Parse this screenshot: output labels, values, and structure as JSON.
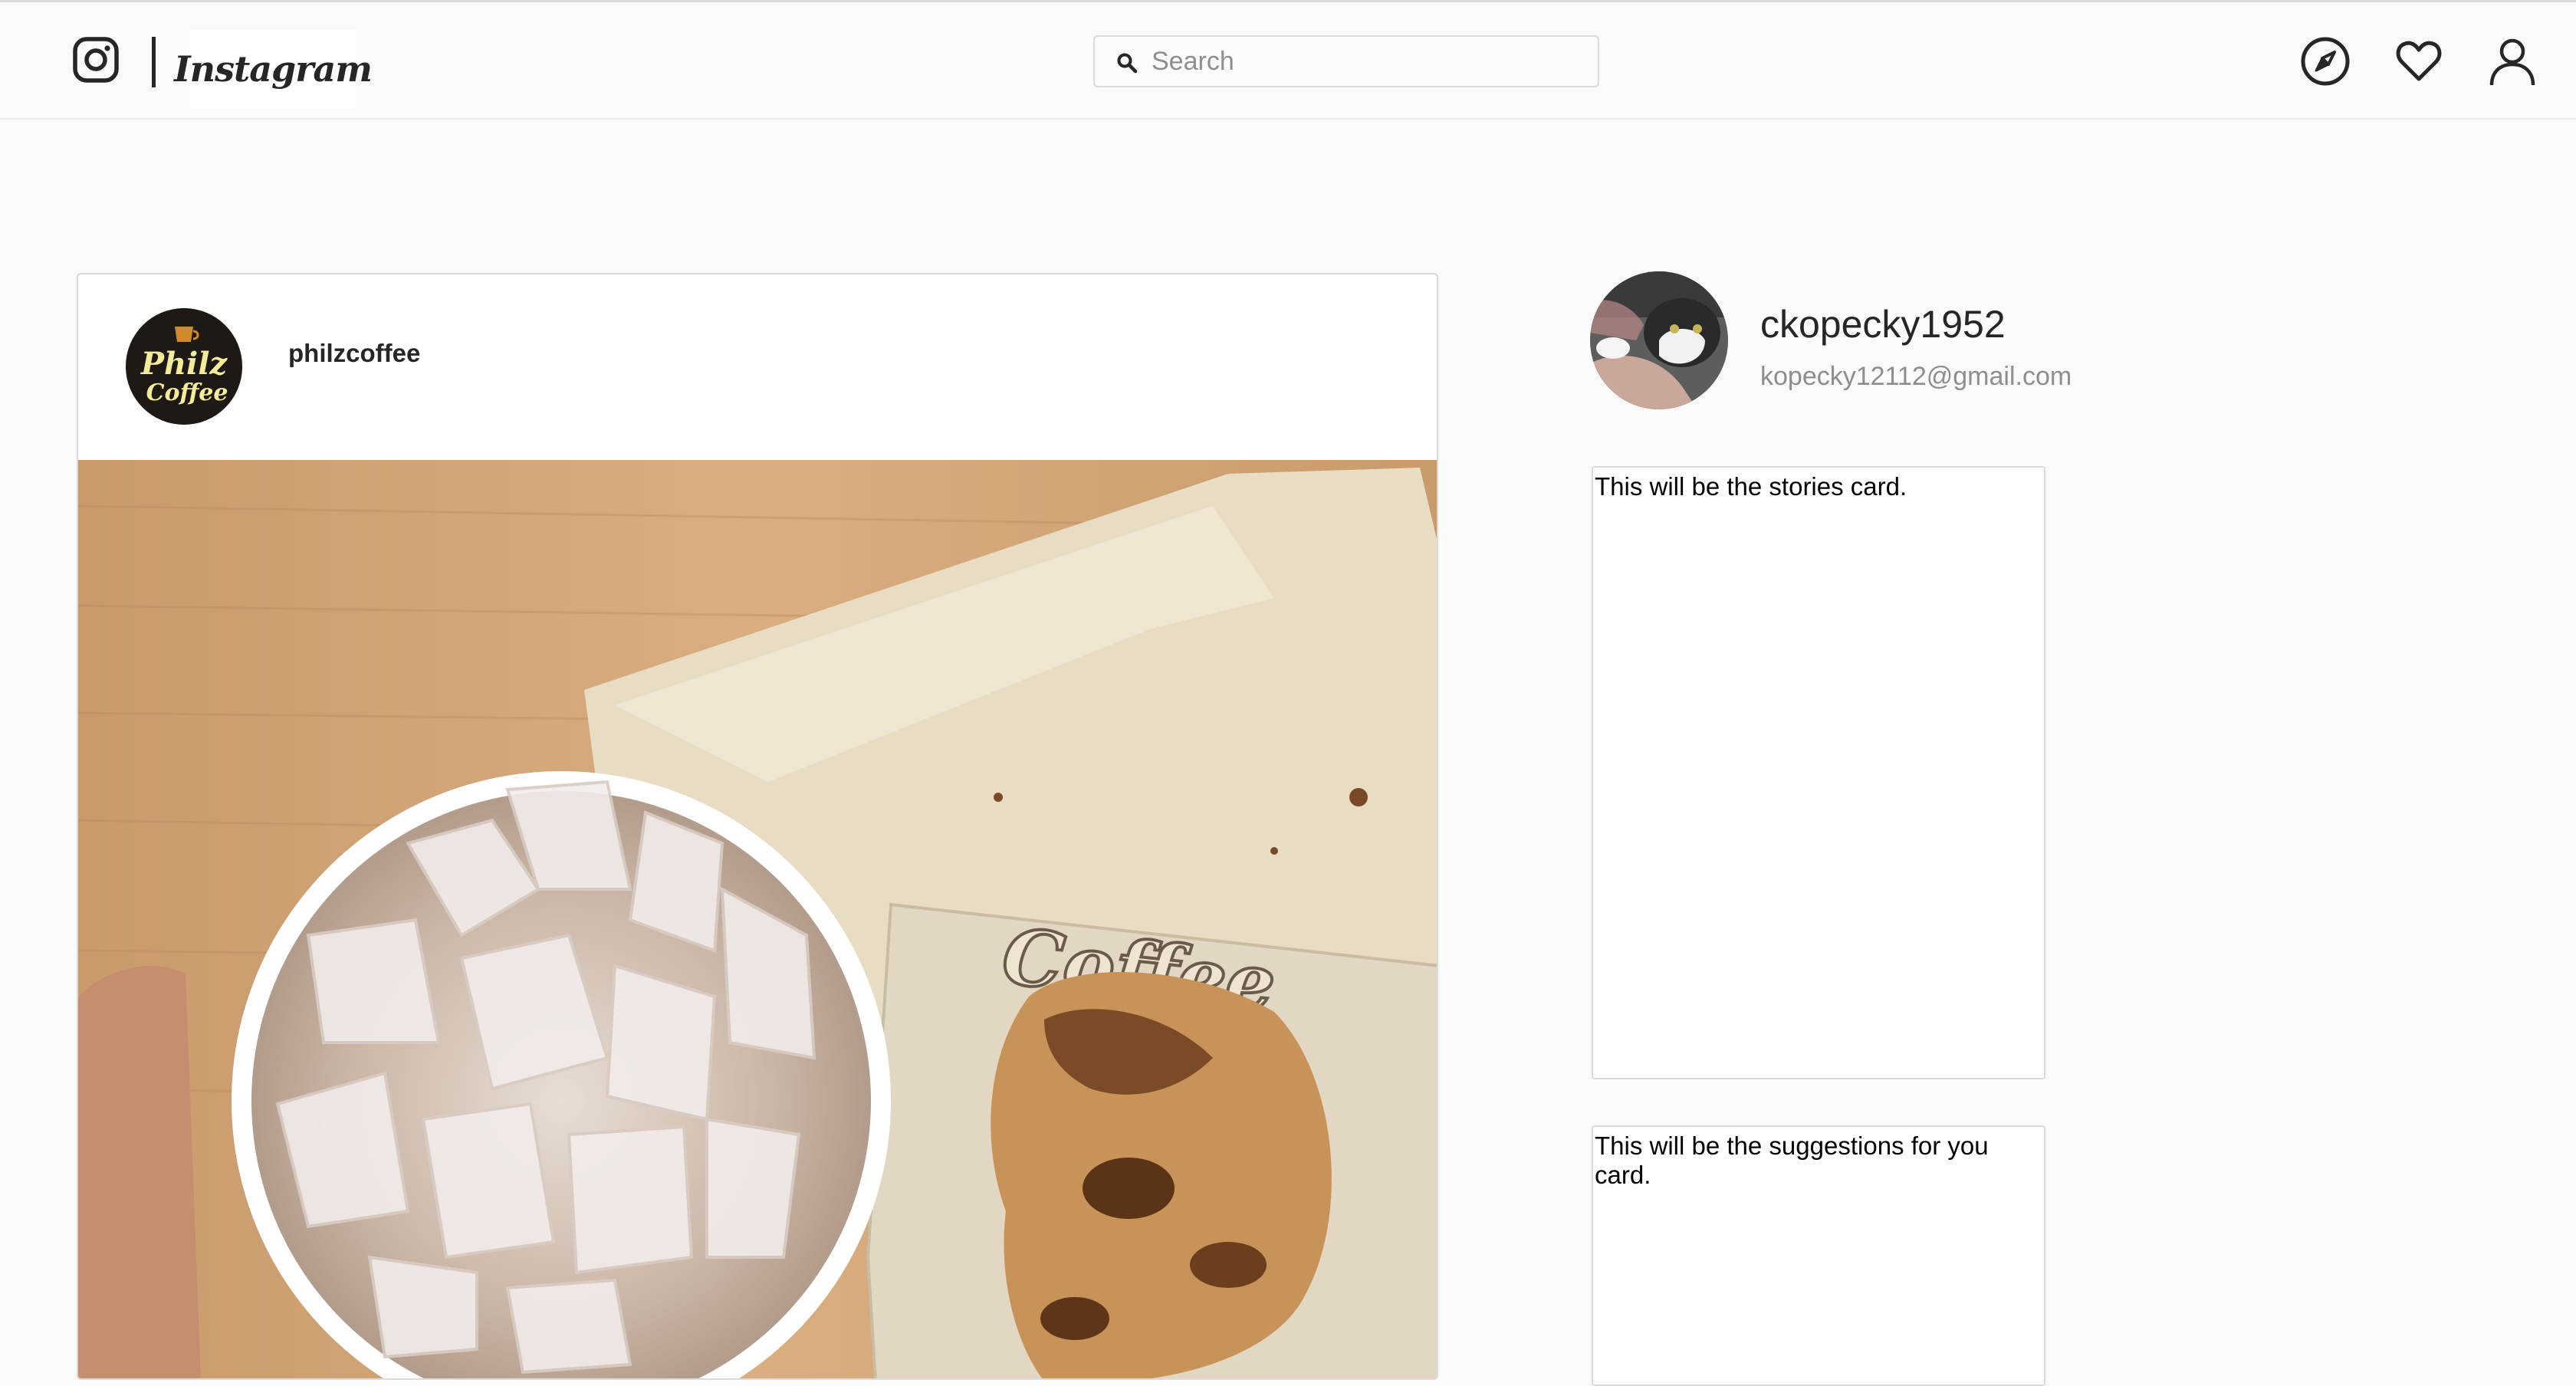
{
  "header": {
    "logo_icon": "instagram-glyph-icon",
    "wordmark": "Instagram",
    "search": {
      "placeholder": "Search",
      "value": "",
      "icon": "search-icon"
    },
    "nav_icons": [
      "compass-icon",
      "heart-icon",
      "user-icon"
    ]
  },
  "post": {
    "username": "philzcoffee",
    "avatar_text": [
      "Philz",
      "Coffee"
    ],
    "image_text": "Coffee"
  },
  "profile": {
    "username": "ckopecky1952",
    "email": "kopecky12112@gmail.com"
  },
  "cards": {
    "stories": "This will be the stories card.",
    "suggestions": "This will be the suggestions for you card."
  },
  "colors": {
    "background": "#fafafa",
    "border": "#dbdbdb",
    "text": "#262626",
    "muted": "#8e8e8e"
  }
}
